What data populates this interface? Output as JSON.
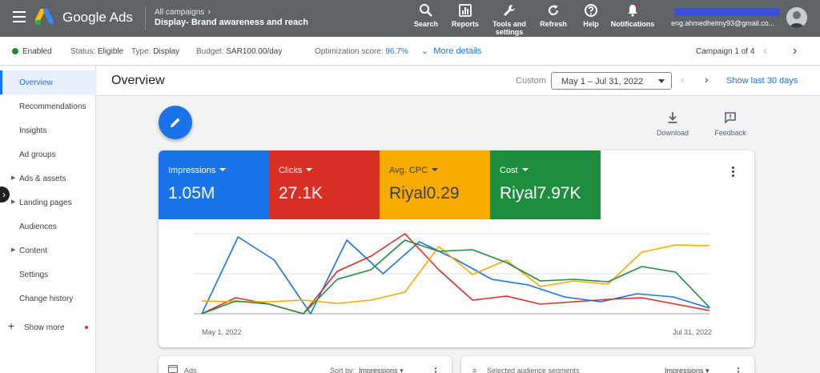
{
  "topbar": {
    "brand": "Google Ads",
    "breadcrumb_all": "All campaigns",
    "breadcrumb_campaign": "Display- Brand awareness and reach",
    "buttons": {
      "search": "Search",
      "reports": "Reports",
      "tools_line1": "Tools and",
      "tools_line2": "settings",
      "refresh": "Refresh",
      "help": "Help",
      "notifications": "Notifications"
    },
    "account_email": "eng.ahmedhelmy93@gmail.co..."
  },
  "statusbar": {
    "enabled": "Enabled",
    "status_label": "Status:",
    "status_value": "Eligible",
    "type_label": "Type:",
    "type_value": "Display",
    "budget_label": "Budget:",
    "budget_value": "SAR100.00/day",
    "opt_label": "Optimization score:",
    "opt_value": "96.7%",
    "more_details": "More details",
    "campaign_counter": "Campaign 1 of 4"
  },
  "sidebar": {
    "items": [
      {
        "label": "Overview"
      },
      {
        "label": "Recommendations"
      },
      {
        "label": "Insights"
      },
      {
        "label": "Ad groups"
      },
      {
        "label": "Ads & assets"
      },
      {
        "label": "Landing pages"
      },
      {
        "label": "Audiences"
      },
      {
        "label": "Content"
      },
      {
        "label": "Settings"
      },
      {
        "label": "Change history"
      }
    ],
    "show_more": "Show more"
  },
  "overview": {
    "title": "Overview",
    "custom_label": "Custom",
    "date_range": "May 1 – Jul 31, 2022",
    "show_last": "Show last 30 days",
    "download": "Download",
    "feedback": "Feedback"
  },
  "metrics": [
    {
      "label": "Impressions",
      "value": "1.05M",
      "color": "#1a73e8"
    },
    {
      "label": "Clicks",
      "value": "27.1K",
      "color": "#d93025"
    },
    {
      "label": "Avg. CPC",
      "value": "Riyal0.29",
      "color": "#f9ab00"
    },
    {
      "label": "Cost",
      "value": "Riyal7.97K",
      "color": "#1e8e3e"
    }
  ],
  "chart_data": {
    "type": "line",
    "x_start_label": "May 1, 2022",
    "x_end_label": "Jul 31, 2022",
    "grid": true,
    "y_range": [
      0,
      100
    ],
    "series": [
      {
        "name": "Impressions",
        "color": "#1a73e8",
        "values": [
          0,
          96,
          67,
          0,
          92,
          50,
          90,
          68,
          43,
          36,
          21,
          15,
          25,
          21,
          7
        ]
      },
      {
        "name": "Clicks",
        "color": "#d93025",
        "values": [
          0,
          20,
          12,
          0,
          53,
          72,
          100,
          55,
          17,
          22,
          12,
          15,
          18,
          20,
          12,
          4
        ]
      },
      {
        "name": "Avg. CPC",
        "color": "#f9ab00",
        "values": [
          16,
          15,
          15,
          17,
          13,
          17,
          27,
          84,
          49,
          67,
          34,
          41,
          37,
          77,
          86,
          85
        ]
      },
      {
        "name": "Cost",
        "color": "#1e8e3e",
        "values": [
          0,
          16,
          12,
          0,
          43,
          55,
          92,
          78,
          80,
          64,
          41,
          43,
          40,
          59,
          52,
          8
        ]
      }
    ]
  },
  "bottom_cards": {
    "ads_title": "Ads",
    "ads_sort_label": "Sort by:",
    "ads_sort_value": "Impressions",
    "audience_title": "Selected audience segments",
    "audience_sort_value": "Impressions"
  }
}
